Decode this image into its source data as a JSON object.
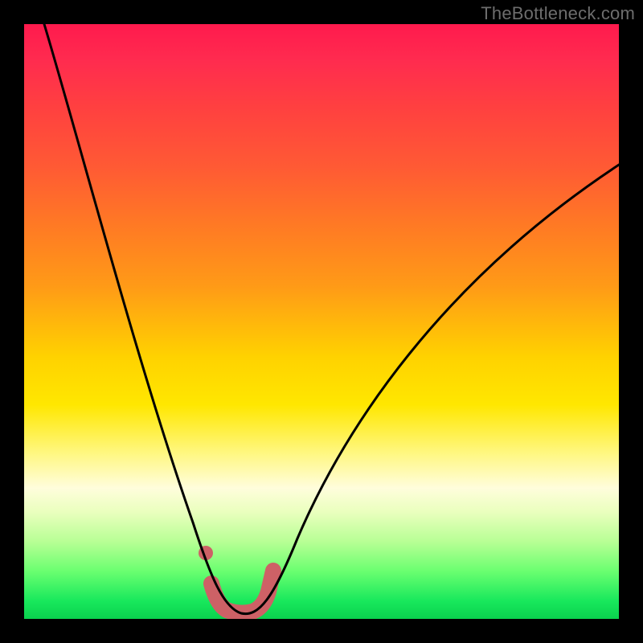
{
  "watermark": "TheBottleneck.com",
  "colors": {
    "background": "#000000",
    "curve": "#000000",
    "blob": "#cd6166",
    "gradient_top": "#ff1a4d",
    "gradient_mid": "#ffe700",
    "gradient_bottom": "#0ad24e"
  },
  "chart_data": {
    "type": "line",
    "title": "",
    "xlabel": "",
    "ylabel": "",
    "xlim": [
      0,
      100
    ],
    "ylim": [
      0,
      100
    ],
    "grid": false,
    "legend_position": "none",
    "annotations": [
      "TheBottleneck.com"
    ],
    "series": [
      {
        "name": "left-branch",
        "x": [
          3,
          5,
          8,
          11,
          14,
          17,
          20,
          23,
          25,
          27,
          29,
          31,
          32.5,
          33.5
        ],
        "y": [
          100,
          92,
          80,
          68,
          56,
          45,
          34,
          24,
          17,
          12,
          8,
          4.5,
          2.5,
          1.5
        ]
      },
      {
        "name": "right-branch",
        "x": [
          40,
          42,
          45,
          49,
          54,
          60,
          67,
          75,
          84,
          93,
          100
        ],
        "y": [
          1.5,
          3,
          7,
          14,
          23,
          33,
          43,
          53,
          62,
          70,
          76
        ]
      },
      {
        "name": "valley-floor",
        "x": [
          33.5,
          35,
          37,
          39,
          40
        ],
        "y": [
          1.5,
          0.8,
          0.5,
          0.8,
          1.5
        ]
      }
    ],
    "highlight_region": {
      "name": "pink-blob",
      "points": [
        {
          "x": 30.5,
          "y": 11
        },
        {
          "x": 31.5,
          "y": 6
        },
        {
          "x": 33,
          "y": 3
        },
        {
          "x": 35,
          "y": 1.5
        },
        {
          "x": 37,
          "y": 1.2
        },
        {
          "x": 39,
          "y": 2
        },
        {
          "x": 40.5,
          "y": 4.5
        },
        {
          "x": 41.5,
          "y": 8.5
        }
      ]
    }
  }
}
